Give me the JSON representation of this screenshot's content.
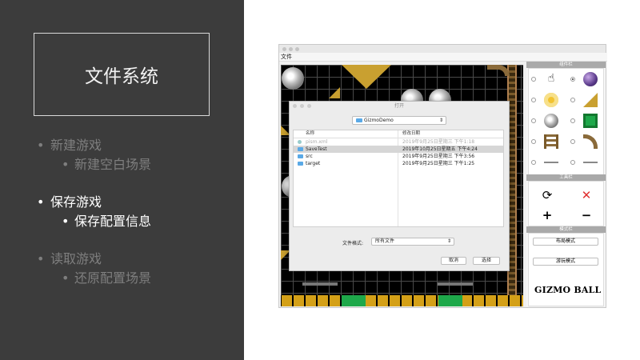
{
  "slide": {
    "title": "文件系统",
    "bullets": [
      {
        "label": "新建游戏",
        "sub": "新建空白场景",
        "state": "dim"
      },
      {
        "label": "保存游戏",
        "sub": "保存配置信息",
        "state": "active"
      },
      {
        "label": "读取游戏",
        "sub": "还原配置场景",
        "state": "dim"
      }
    ]
  },
  "app": {
    "menu": {
      "file": "文件"
    },
    "dialog": {
      "title": "打开",
      "folder": "GizmoDemo",
      "columns": {
        "name": "名称",
        "modified": "修改日期"
      },
      "rows": [
        {
          "name": "pism.xml",
          "date": "2019年9月25日星期三 下午1:18",
          "state": "grey"
        },
        {
          "name": "SaveTest",
          "date": "2019年10月25日星期五 下午4:24",
          "state": "selected"
        },
        {
          "name": "src",
          "date": "2019年9月25日星期三 下午3:56",
          "state": "normal"
        },
        {
          "name": "target",
          "date": "2019年9月25日星期三 下午1:25",
          "state": "normal"
        }
      ],
      "format_label": "文件格式:",
      "format_value": "所有文件",
      "cancel": "取消",
      "choose": "选择"
    },
    "panel": {
      "components_title": "组件栏",
      "tools_title": "工具栏",
      "modes_title": "模式栏",
      "layout_mode": "布局模式",
      "play_mode": "游玩模式",
      "logo": "GIZMO BALL"
    },
    "colors": {
      "slide_bg": "#3c3c3c",
      "delete_icon": "#e03030",
      "selection": "#d6d6d6"
    }
  }
}
